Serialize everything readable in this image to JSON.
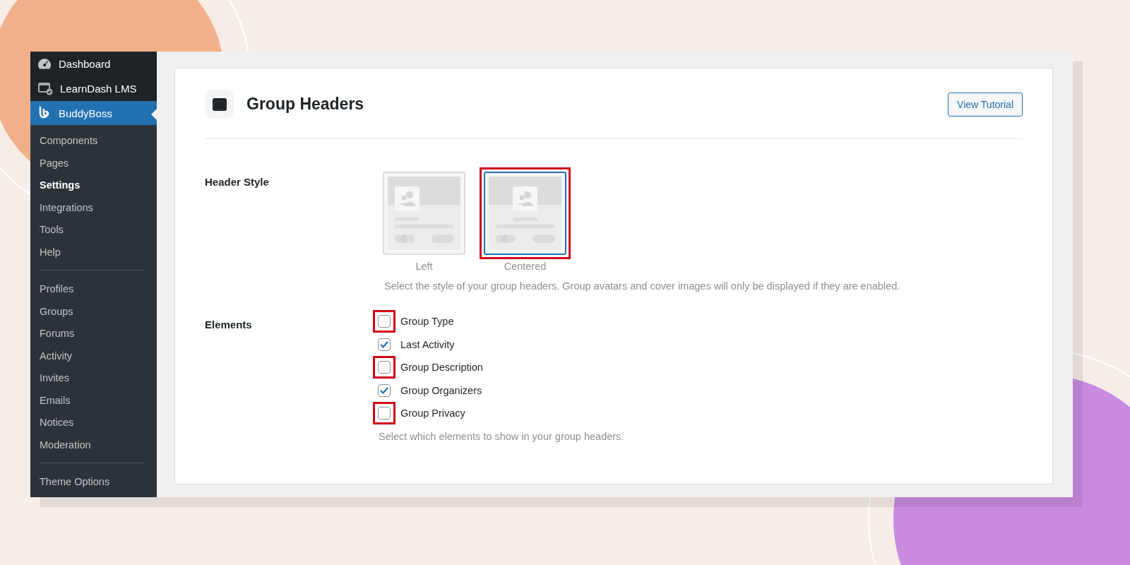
{
  "sidebar": {
    "top_items": [
      {
        "label": "Dashboard",
        "selected": false
      },
      {
        "label": "LearnDash LMS",
        "selected": false
      },
      {
        "label": "BuddyBoss",
        "selected": true
      }
    ],
    "sections": [
      [
        {
          "label": "Components",
          "selected": false
        },
        {
          "label": "Pages",
          "selected": false
        },
        {
          "label": "Settings",
          "selected": true
        },
        {
          "label": "Integrations",
          "selected": false
        },
        {
          "label": "Tools",
          "selected": false
        },
        {
          "label": "Help",
          "selected": false
        }
      ],
      [
        {
          "label": "Profiles",
          "selected": false
        },
        {
          "label": "Groups",
          "selected": false
        },
        {
          "label": "Forums",
          "selected": false
        },
        {
          "label": "Activity",
          "selected": false
        },
        {
          "label": "Invites",
          "selected": false
        },
        {
          "label": "Emails",
          "selected": false
        },
        {
          "label": "Notices",
          "selected": false
        },
        {
          "label": "Moderation",
          "selected": false
        }
      ],
      [
        {
          "label": "Theme Options",
          "selected": false
        }
      ]
    ]
  },
  "panel": {
    "title": "Group Headers",
    "tutorial_button": "View Tutorial",
    "header_style": {
      "label": "Header Style",
      "options": [
        {
          "label": "Left",
          "kind": "left",
          "selected": false,
          "highlighted": false
        },
        {
          "label": "Centered",
          "kind": "centered",
          "selected": true,
          "highlighted": true
        }
      ],
      "help": "Select the style of your group headers. Group avatars and cover images will only be displayed if they are enabled."
    },
    "elements": {
      "label": "Elements",
      "items": [
        {
          "label": "Group Type",
          "checked": false,
          "highlighted": true
        },
        {
          "label": "Last Activity",
          "checked": true,
          "highlighted": false
        },
        {
          "label": "Group Description",
          "checked": false,
          "highlighted": true
        },
        {
          "label": "Group Organizers",
          "checked": true,
          "highlighted": false
        },
        {
          "label": "Group Privacy",
          "checked": false,
          "highlighted": true
        }
      ],
      "help": "Select which elements to show in your group headers."
    }
  }
}
